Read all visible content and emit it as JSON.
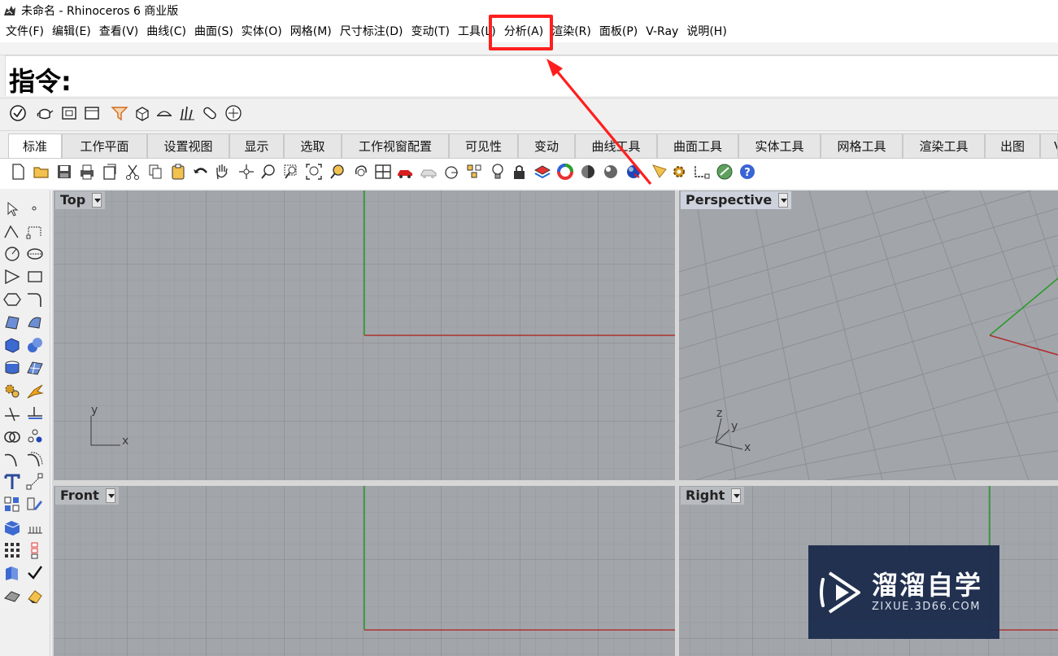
{
  "window": {
    "title": "未命名 - Rhinoceros 6 商业版"
  },
  "menu": [
    "文件(F)",
    "编辑(E)",
    "查看(V)",
    "曲线(C)",
    "曲面(S)",
    "实体(O)",
    "网格(M)",
    "尺寸标注(D)",
    "变动(T)",
    "工具(L)",
    "分析(A)",
    "渲染(R)",
    "面板(P)",
    "V-Ray",
    "说明(H)"
  ],
  "command": {
    "label": "指令:"
  },
  "tabs": [
    "标准",
    "工作平面",
    "设置视图",
    "显示",
    "选取",
    "工作视窗配置",
    "可见性",
    "变动",
    "曲线工具",
    "曲面工具",
    "实体工具",
    "网格工具",
    "渲染工具",
    "出图",
    "V"
  ],
  "viewports": {
    "top": {
      "label": "Top",
      "axis_y": "y",
      "axis_x": "x"
    },
    "perspective": {
      "label": "Perspective",
      "axis_z": "z",
      "axis_y": "y",
      "axis_x": "x"
    },
    "front": {
      "label": "Front"
    },
    "right": {
      "label": "Right"
    }
  },
  "annotation": {
    "highlighted_menu": "工具(L)",
    "color": "#ff1e1e"
  },
  "watermark": {
    "brand_cn": "溜溜自学",
    "brand_url": "ZIXUE.3D66.COM"
  },
  "colors": {
    "grid_bg": "#a2a6ab",
    "axis_x": "#b03030",
    "axis_y": "#2a9a2a"
  }
}
